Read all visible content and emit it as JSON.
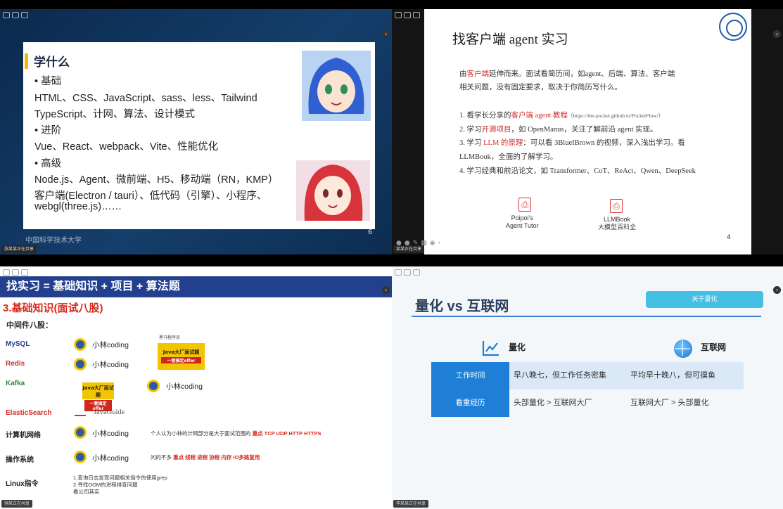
{
  "tiles": {
    "tl": {
      "share": "张某某正在共享"
    },
    "tr": {
      "share": "某某正在共享"
    },
    "bl": {
      "share": "钟某正在共享"
    },
    "br": {
      "share": "李某某正在共享"
    }
  },
  "tl": {
    "heading": "学什么",
    "lines": [
      "• 基础",
      "HTML、CSS、JavaScript、sass、less、Tailwind",
      "TypeScript、计网、算法、设计模式",
      "• 进阶",
      "Vue、React、webpack、Vite、性能优化",
      "• 高级",
      "Node.js、Agent、微前端、H5、移动端（RN，KMP）",
      "客户端(Electron / tauri）、低代码（引擎）、小程序、",
      "webgl(three.js)……"
    ],
    "footer": "中国科学技术大学",
    "page": "6"
  },
  "tr": {
    "title": "找客户端 agent 实习",
    "intro1_a": "由",
    "intro1_b": "客户端",
    "intro1_c": "延伸而来。面试看简历间，如agent、后端、算法、客户端",
    "intro2": "相关问题，没有固定要求，取决于你简历写什么。",
    "item1_a": "1. 看学长分享的",
    "item1_b": "客户端 agent 教程",
    "item1_c": "（https://the-pocket.github.io/",
    "item1_d": "PocketFlow",
    "item1_e": "/）",
    "item2_a": "2. 学习",
    "item2_b": "开源项目",
    "item2_c": "，如 OpenManus，关注了解前沿 agent 实现。",
    "item3_a": "3. 学习 ",
    "item3_b": "LLM 的原理",
    "item3_c": "：可以看 3BlueIBrown 的视频，深入浅出学习。看",
    "item3_d": "LLMBook，全面的了解学习。",
    "item4": "4. 学习经典和前沿论文，如 Transformer、CoT、ReAct、Qwen、DeepSeek",
    "file1_l1": "Poipoi's",
    "file1_l2": "Agent Tutor",
    "file2_l1": "LLMBook",
    "file2_l2": "大模型百科全",
    "page": "4"
  },
  "bl": {
    "banner": "找实习 = 基础知识 + 项目 + 算法题",
    "subtitle": "3.基础知识(面试八股)",
    "mid": "中间件八股：",
    "rows": [
      {
        "label": "MySQL",
        "src": "小林coding"
      },
      {
        "label": "Redis",
        "src": "小林coding"
      },
      {
        "label": "Kafka",
        "src": "小林coding"
      },
      {
        "label": "ElasticSearch",
        "src": "JavaGuide"
      },
      {
        "label": "计算机网络",
        "src": "小林coding"
      },
      {
        "label": "操作系统",
        "src": "小林coding"
      },
      {
        "label": "Linux指令",
        "src": ""
      }
    ],
    "jcard_title": "Java大厂面试题",
    "jcard_sub": "一套搞定offer",
    "jcard_brand": "黑马程序员",
    "net_note_a": "个人认为小林的计网部分是大于面试范围的 ",
    "net_note_b": "重点 TCP UDP HTTP HTTPS",
    "os_note_a": "问的不多 ",
    "os_note_b": "重点 线程 进程 协程 内存 IO多路复用",
    "linux1": "1.查询日志发现问题相关指令的使用grep",
    "linux2": "2.寻找OOM的进程排查问题",
    "linux3": "看公司其实"
  },
  "br": {
    "title": "量化 vs 互联网",
    "tag": "关于量化",
    "col1": "量化",
    "col2": "互联网",
    "row1": {
      "label": "工作时间",
      "a": "早八晚七，但工作任务密集",
      "b": "平均早十晚八，但可摸鱼"
    },
    "row2": {
      "label": "看重经历",
      "a": "头部量化 > 互联网大厂",
      "b": "互联网大厂 > 头部量化"
    }
  },
  "colors": {
    "banner": "#23408e",
    "accent_red": "#d82a1e",
    "accent_blue": "#1f7fd6"
  }
}
